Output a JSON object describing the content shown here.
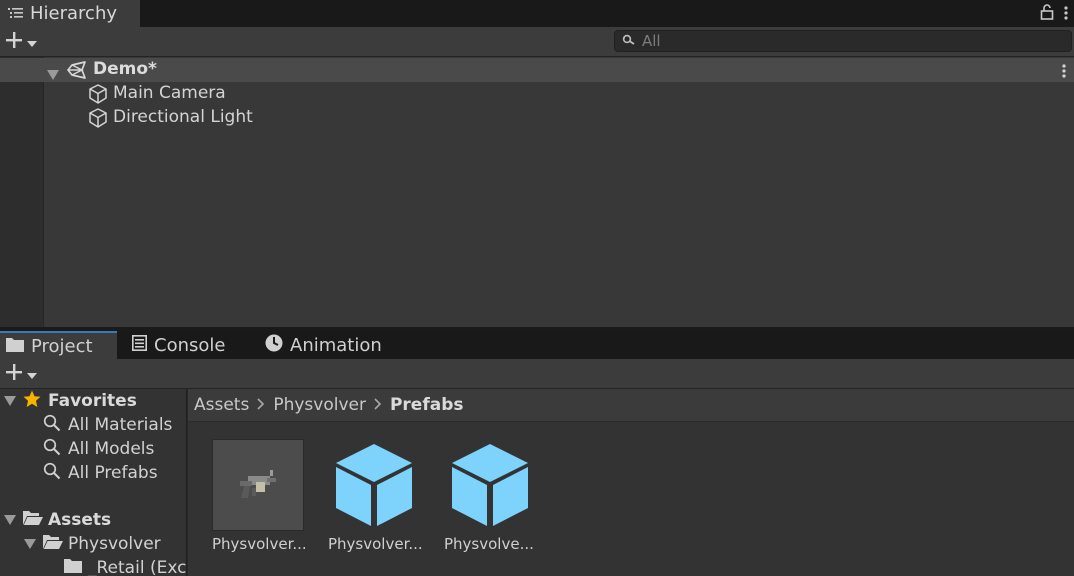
{
  "hierarchy": {
    "tab_title": "Hierarchy",
    "search_placeholder": "All",
    "scene_name": "Demo*",
    "objects": [
      "Main Camera",
      "Directional Light"
    ]
  },
  "project": {
    "tabs": [
      "Project",
      "Console",
      "Animation"
    ],
    "favorites": {
      "label": "Favorites",
      "items": [
        "All Materials",
        "All Models",
        "All Prefabs"
      ]
    },
    "assets_label": "Assets",
    "folders": [
      "Physvolver",
      "_Retail (Exc"
    ],
    "breadcrumb": [
      "Assets",
      "Physvolver",
      "Prefabs"
    ],
    "items": [
      {
        "label": "Physvolver...",
        "icon": "model-thumbnail"
      },
      {
        "label": "Physvolver...",
        "icon": "prefab-cube-icon"
      },
      {
        "label": "Physvolve...",
        "icon": "prefab-cube-icon"
      }
    ]
  },
  "colors": {
    "accent_tab": "#3a79bb",
    "prefab_blue": "#7dd3fc"
  }
}
